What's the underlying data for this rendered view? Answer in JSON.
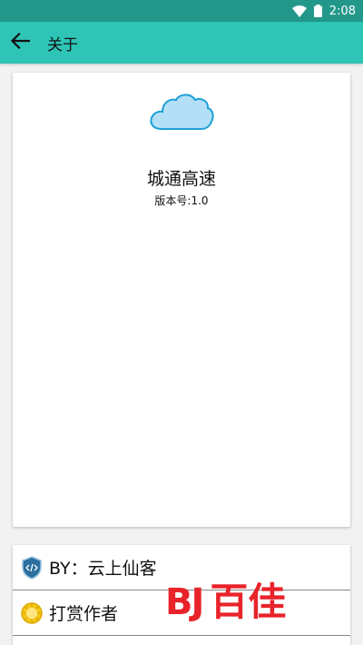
{
  "status_bar": {
    "time": "2:08"
  },
  "app_bar": {
    "title": "关于"
  },
  "about": {
    "app_name": "城通高速",
    "version": "版本号:1.0"
  },
  "info_rows": [
    {
      "label": "BY：云上仙客",
      "icon": "shield-code-icon"
    },
    {
      "label": "打赏作者",
      "icon": "reward-icon"
    }
  ],
  "watermark": {
    "logo": "BJ",
    "text": "百佳"
  },
  "colors": {
    "status_bar": "#23988a",
    "app_bar": "#2ec4b6",
    "cloud_fill": "#b3e0f7",
    "cloud_stroke": "#1e9fd6",
    "watermark": "#e8232a"
  }
}
